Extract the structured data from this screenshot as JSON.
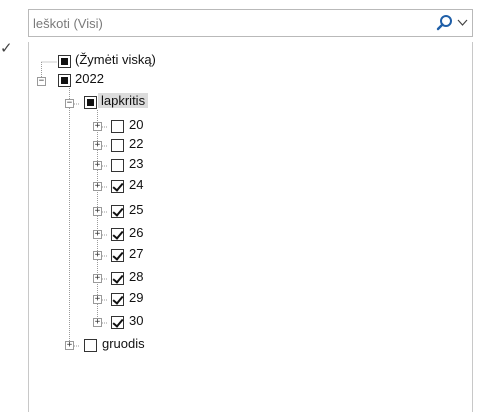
{
  "left_marker": "✓",
  "search": {
    "placeholder": "leškoti (Visi)"
  },
  "tree": {
    "select_all": {
      "label": "(Žymėti viską)",
      "state": "partial"
    },
    "year": {
      "label": "2022",
      "state": "partial",
      "expanded": true
    },
    "month": {
      "label": "lapkritis",
      "state": "partial",
      "expanded": true,
      "selected": true
    },
    "days": [
      {
        "label": "20",
        "checked": false
      },
      {
        "label": "22",
        "checked": false
      },
      {
        "label": "23",
        "checked": false
      },
      {
        "label": "24",
        "checked": true
      },
      {
        "label": "25",
        "checked": true
      },
      {
        "label": "26",
        "checked": true
      },
      {
        "label": "27",
        "checked": true
      },
      {
        "label": "28",
        "checked": true
      },
      {
        "label": "29",
        "checked": true
      },
      {
        "label": "30",
        "checked": true
      }
    ],
    "other_month": {
      "label": "gruodis",
      "state": "unchecked",
      "expanded": false
    }
  },
  "colors": {
    "border": "#b9b9b9",
    "search_icon": "#1f5fa8",
    "selection": "#dcdcdc"
  },
  "icons": {
    "search": "search-icon",
    "dropdown": "chevron-down-icon"
  }
}
